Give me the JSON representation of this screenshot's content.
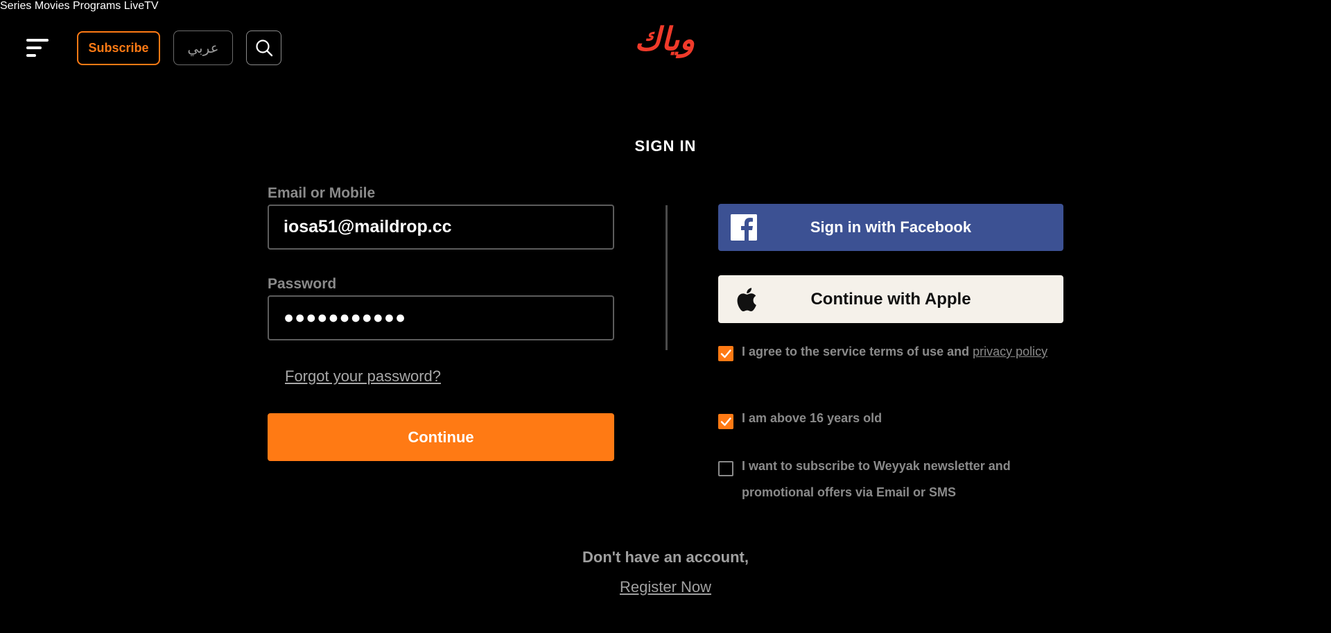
{
  "header": {
    "subscribe_label": "Subscribe",
    "language_label": "عربي",
    "logo_text": "وياك",
    "nav": [
      {
        "label": "Series"
      },
      {
        "label": "Movies"
      },
      {
        "label": "Programs"
      },
      {
        "label": "LiveTV"
      }
    ]
  },
  "signin": {
    "title": "SIGN IN",
    "email_label": "Email or Mobile",
    "email_value": "iosa51@maildrop.cc",
    "password_label": "Password",
    "password_value": "●●●●●●●●●●●",
    "forgot_label": "Forgot your password?",
    "continue_label": "Continue"
  },
  "social": {
    "facebook_label": "Sign in with Facebook",
    "apple_label": "Continue with Apple"
  },
  "consents": {
    "terms_prefix": "I agree to the service terms of use and ",
    "terms_link": "privacy policy",
    "terms_checked": true,
    "age_label": "I am above 16 years old",
    "age_checked": true,
    "newsletter_label": "I want to subscribe to Weyyak newsletter and promotional offers via Email or SMS",
    "newsletter_checked": false
  },
  "footer": {
    "no_account": "Don't have an account,",
    "register_label": "Register Now"
  },
  "colors": {
    "accent": "#ff7a14",
    "facebook": "#3c5193",
    "apple_bg": "#f5f1ea",
    "logo": "#f03a2a",
    "background": "#000000"
  },
  "icons": [
    "menu-icon",
    "search-icon",
    "facebook-icon",
    "apple-icon",
    "checkmark-icon"
  ]
}
